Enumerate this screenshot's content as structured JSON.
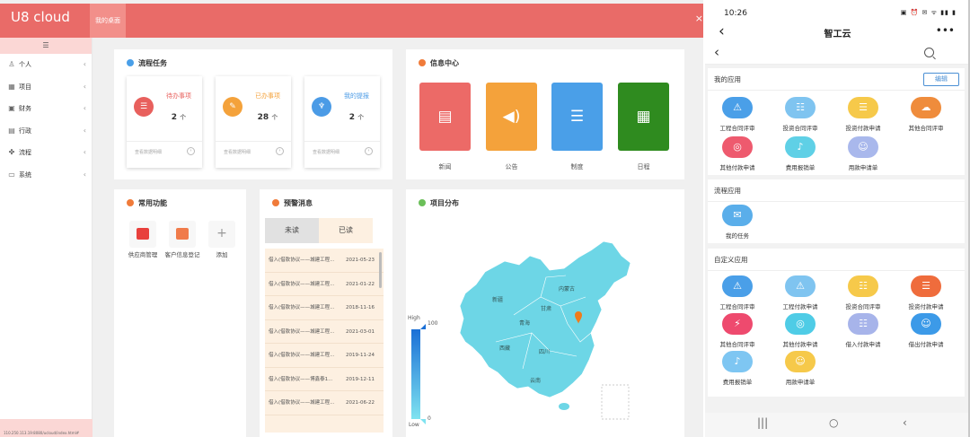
{
  "web": {
    "brand": "U8 cloud",
    "active_tab": "我的桌面",
    "close": "×",
    "sidebar": {
      "toggle": "☰",
      "items": [
        {
          "icon": "user-icon",
          "glyph": "♙",
          "label": "个人"
        },
        {
          "icon": "project-icon",
          "glyph": "▦",
          "label": "项目"
        },
        {
          "icon": "finance-icon",
          "glyph": "▣",
          "label": "财务"
        },
        {
          "icon": "admin-icon",
          "glyph": "▤",
          "label": "行政"
        },
        {
          "icon": "workflow-icon",
          "glyph": "✤",
          "label": "流程"
        },
        {
          "icon": "system-icon",
          "glyph": "▭",
          "label": "系统"
        }
      ],
      "footer": "110.250.113.19:8080/ucloud/index.html#"
    },
    "flow": {
      "title": "流程任务",
      "cards": [
        {
          "title": "待办事项",
          "count": "2",
          "unit": "个",
          "link": "查看数据明细",
          "color": "#e8605d",
          "icon": "todo-icon",
          "glyph": "☰"
        },
        {
          "title": "已办事项",
          "count": "28",
          "unit": "个",
          "link": "查看数据明细",
          "color": "#f4a23b",
          "icon": "tag-icon",
          "glyph": "✎"
        },
        {
          "title": "我的提报",
          "count": "2",
          "unit": "个",
          "link": "查看数据明细",
          "color": "#4b9be6",
          "icon": "trophy-icon",
          "glyph": "♆"
        }
      ]
    },
    "info": {
      "title": "信息中心",
      "tiles": [
        {
          "label": "新闻",
          "color": "#ec6a67",
          "icon": "document-icon",
          "glyph": "▤"
        },
        {
          "label": "公告",
          "color": "#f4a23b",
          "icon": "speaker-icon",
          "glyph": "◀)"
        },
        {
          "label": "制度",
          "color": "#4a9fe8",
          "icon": "list-icon",
          "glyph": "☰"
        },
        {
          "label": "日程",
          "color": "#2f8b1f",
          "icon": "calendar-icon",
          "glyph": "▦"
        }
      ]
    },
    "common": {
      "title": "常用功能",
      "items": [
        {
          "label": "供应商管理",
          "color": "#e8403c",
          "icon": "monitor-icon"
        },
        {
          "label": "客户信息登记",
          "color": "#f07b4a",
          "icon": "contact-card-icon"
        },
        {
          "label": "添加",
          "color": "#aaaaaa",
          "icon": "plus-icon"
        }
      ]
    },
    "alert": {
      "title": "预警消息",
      "tabs": [
        "未读",
        "已读"
      ],
      "rows": [
        {
          "text": "借入(借款协议——城建工程...",
          "date": "2021-05-23"
        },
        {
          "text": "借入(借款协议——城建工程...",
          "date": "2021-01-22"
        },
        {
          "text": "借入(借款协议——城建工程...",
          "date": "2018-11-16"
        },
        {
          "text": "借入(借款协议——城建工程...",
          "date": "2021-03-01"
        },
        {
          "text": "借入(借款协议——城建工程...",
          "date": "2019-11-24"
        },
        {
          "text": "借入(借款协议——博鑫泰1...",
          "date": "2019-12-11"
        },
        {
          "text": "借入(借款协议——城建工程...",
          "date": "2021-06-22"
        }
      ]
    },
    "map": {
      "title": "项目分布",
      "legend_high": "High",
      "legend_low": "Low",
      "legend_max": "100",
      "legend_min": "0",
      "fill_color": "#6dd6e6",
      "labels": [
        "新疆",
        "西藏",
        "青海",
        "甘肃",
        "四川",
        "云南",
        "内蒙古"
      ]
    }
  },
  "phone": {
    "time": "10:26",
    "status_icons": "▣ ⏰ ✉ ᯤ ▮▮ ▮",
    "title": "智工云",
    "back": "‹",
    "more": "•••",
    "my_apps": {
      "title": "我的应用",
      "edit": "编辑",
      "items": [
        {
          "label": "工程合同评审",
          "color": "#4a9fe8",
          "icon": "warning-icon",
          "glyph": "⚠"
        },
        {
          "label": "投资合同评审",
          "color": "#7fc4f0",
          "icon": "chat-icon",
          "glyph": "☷"
        },
        {
          "label": "投资付款申请",
          "color": "#f6c94a",
          "icon": "list-icon",
          "glyph": "☰"
        },
        {
          "label": "其他合同评审",
          "color": "#ef8c3c",
          "icon": "message-icon",
          "glyph": "☁"
        },
        {
          "label": "其他付款申请",
          "color": "#ee5a6e",
          "icon": "money-icon",
          "glyph": "◎"
        },
        {
          "label": "费用报销单",
          "color": "#5fd0e6",
          "icon": "bell-icon",
          "glyph": "♪"
        },
        {
          "label": "用款申请单",
          "color": "#a9b8ec",
          "icon": "person-icon",
          "glyph": "☺"
        }
      ]
    },
    "flow_apps": {
      "title": "流程应用",
      "items": [
        {
          "label": "我的任务",
          "color": "#5aaeea",
          "icon": "mail-icon",
          "glyph": "✉"
        }
      ]
    },
    "custom_apps": {
      "title": "自定义应用",
      "items": [
        {
          "label": "工程合同评审",
          "color": "#4a9fe8",
          "icon": "warning-icon",
          "glyph": "⚠"
        },
        {
          "label": "工程付款申请",
          "color": "#7fc4f0",
          "icon": "warning-outline-icon",
          "glyph": "⚠"
        },
        {
          "label": "投资合同评审",
          "color": "#f6c94a",
          "icon": "chat-icon",
          "glyph": "☷"
        },
        {
          "label": "投资付款申请",
          "color": "#ef6c3c",
          "icon": "list-icon",
          "glyph": "☰"
        },
        {
          "label": "其他合同评审",
          "color": "#ee4a6e",
          "icon": "messenger-icon",
          "glyph": "⚡"
        },
        {
          "label": "其他付款申请",
          "color": "#4fcce6",
          "icon": "money-icon",
          "glyph": "◎"
        },
        {
          "label": "借入付款申请",
          "color": "#a7b4ea",
          "icon": "chat-bubble-icon",
          "glyph": "☷"
        },
        {
          "label": "借出付款申请",
          "color": "#3c9ae8",
          "icon": "smile-icon",
          "glyph": "☺"
        },
        {
          "label": "费用报销单",
          "color": "#7ec6f2",
          "icon": "bell-icon",
          "glyph": "♪"
        },
        {
          "label": "用款申请单",
          "color": "#f6c94a",
          "icon": "person-icon",
          "glyph": "☺"
        }
      ]
    },
    "dock": {
      "recent": "|||",
      "home": "○",
      "back": "‹"
    }
  }
}
